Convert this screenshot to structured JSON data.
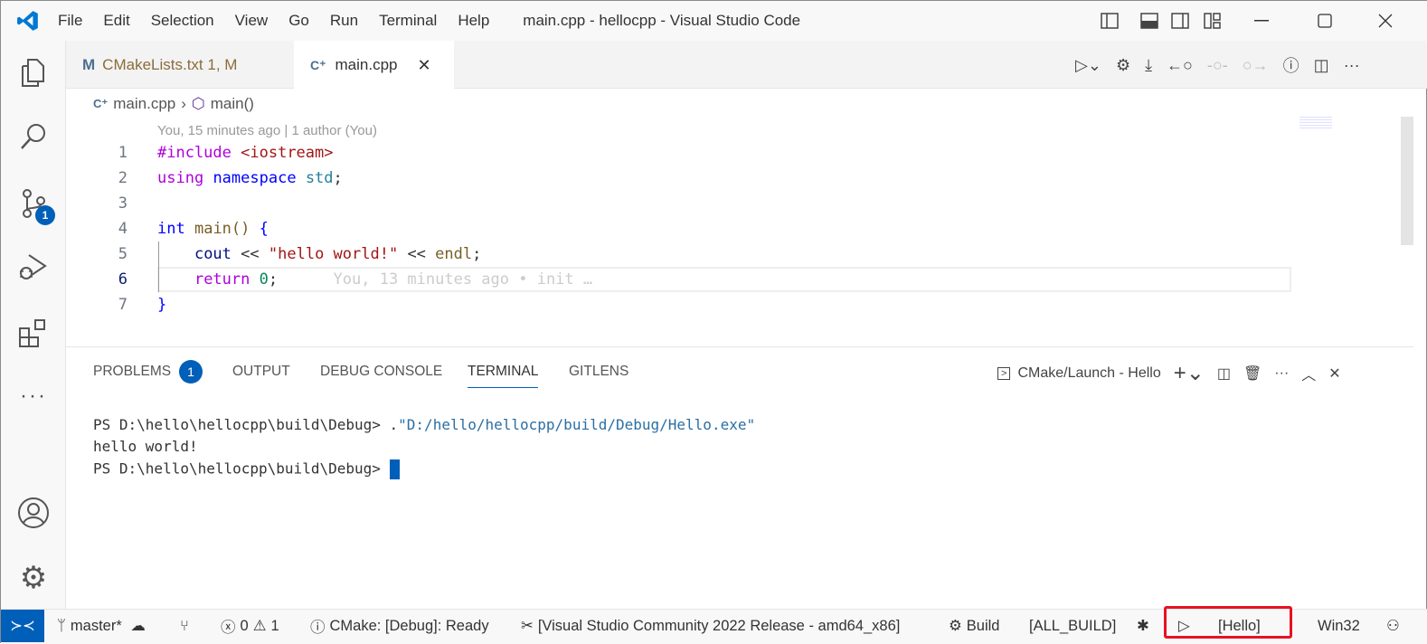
{
  "title_bar": {
    "menu": [
      "File",
      "Edit",
      "Selection",
      "View",
      "Go",
      "Run",
      "Terminal",
      "Help"
    ],
    "title": "main.cpp - hellocpp - Visual Studio Code"
  },
  "activity_bar": {
    "source_control_badge": "1"
  },
  "tabs": [
    {
      "label": "CMakeLists.txt 1, M",
      "icon": "M"
    },
    {
      "label": "main.cpp",
      "active": true
    }
  ],
  "breadcrumb": {
    "file": "main.cpp",
    "symbol": "main()"
  },
  "codelens": "You, 15 minutes ago | 1 author (You)",
  "code": {
    "line_numbers": [
      "1",
      "2",
      "3",
      "4",
      "5",
      "6",
      "7"
    ],
    "blame": "You, 13 minutes ago • init …",
    "l1": [
      "#include",
      "<iostream>"
    ],
    "l2": [
      "using",
      "namespace",
      "std",
      ";"
    ],
    "l4": [
      "int",
      "main",
      "()",
      "{"
    ],
    "l5": [
      "cout",
      "<<",
      "\"hello world!\"",
      "<<",
      "endl",
      ";"
    ],
    "l6": [
      "return",
      "0",
      ";"
    ],
    "l7": "}"
  },
  "panel": {
    "tabs": [
      "PROBLEMS",
      "OUTPUT",
      "DEBUG CONSOLE",
      "TERMINAL",
      "GITLENS"
    ],
    "problems_badge": "1",
    "terminal_name": "CMake/Launch - Hello",
    "lines": {
      "prompt": "PS D:\\hello\\hellocpp\\build\\Debug> ",
      "cmd_dot": ".",
      "cmd_str": "\"D:/hello/hellocpp/build/Debug/Hello.exe\"",
      "out": "hello world!"
    }
  },
  "status_bar": {
    "branch": "master*",
    "errors": "0",
    "warnings": "1",
    "cmake_status": "CMake: [Debug]: Ready",
    "kit": "[Visual Studio Community 2022 Release - amd64_x86]",
    "build": "Build",
    "target": "[ALL_BUILD]",
    "launch_target": "[Hello]",
    "platform": "Win32"
  },
  "colors": {
    "accent": "#005fb8",
    "highlight": "#e81123"
  }
}
